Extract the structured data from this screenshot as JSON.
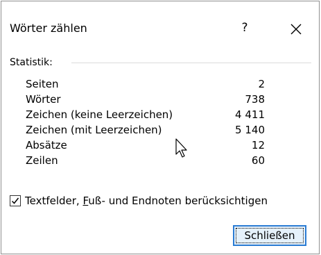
{
  "window": {
    "title": "Wörter zählen",
    "help_label": "?",
    "close_icon": "close-icon"
  },
  "statistics": {
    "section_label": "Statistik:",
    "rows": [
      {
        "label": "Seiten",
        "value": "2"
      },
      {
        "label": "Wörter",
        "value": "738"
      },
      {
        "label": "Zeichen (keine Leerzeichen)",
        "value": "4 411"
      },
      {
        "label": "Zeichen (mit Leerzeichen)",
        "value": "5 140"
      },
      {
        "label": "Absätze",
        "value": "12"
      },
      {
        "label": "Zeilen",
        "value": "60"
      }
    ]
  },
  "options": {
    "include_textboxes": {
      "checked": true,
      "label_pre": "Textfelder, ",
      "label_accel": "F",
      "label_post": "uß- und Endnoten berücksichtigen"
    }
  },
  "buttons": {
    "close_label": "Schließen"
  },
  "colors": {
    "accent": "#2b7cd3",
    "button_bg": "#e5f1fb",
    "divider": "#dcdcdc"
  }
}
